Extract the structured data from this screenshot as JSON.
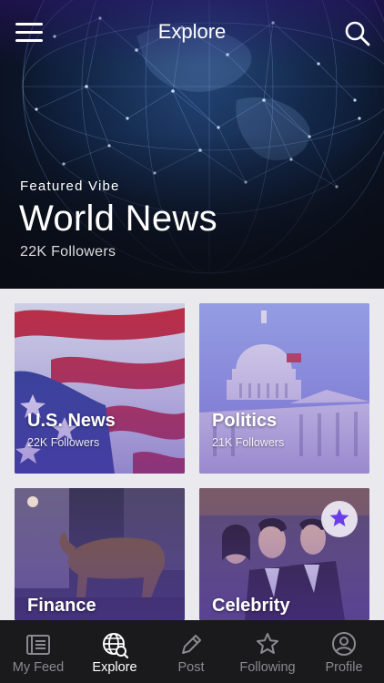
{
  "header": {
    "title": "Explore",
    "menu_icon": "menu-icon",
    "search_icon": "search-icon"
  },
  "featured": {
    "label": "Featured Vibe",
    "title": "World News",
    "followers": "22K Followers"
  },
  "categories": [
    {
      "name": "U.S. News",
      "followers": "22K Followers"
    },
    {
      "name": "Politics",
      "followers": "21K Followers"
    },
    {
      "name": "Finance",
      "followers": ""
    },
    {
      "name": "Celebrity",
      "followers": ""
    }
  ],
  "favorite_badge": {
    "icon": "star-icon"
  },
  "tabbar": {
    "tabs": [
      {
        "label": "My Feed",
        "icon": "feed-icon"
      },
      {
        "label": "Explore",
        "icon": "globe-icon"
      },
      {
        "label": "Post",
        "icon": "pencil-icon"
      },
      {
        "label": "Following",
        "icon": "star-outline-icon"
      },
      {
        "label": "Profile",
        "icon": "profile-icon"
      }
    ],
    "active": "Explore"
  },
  "colors": {
    "accent": "#6a3de8",
    "tab_active": "#ffffff",
    "tab_inactive": "#8a8a8f",
    "tabbar_bg": "#1a1a1c"
  }
}
